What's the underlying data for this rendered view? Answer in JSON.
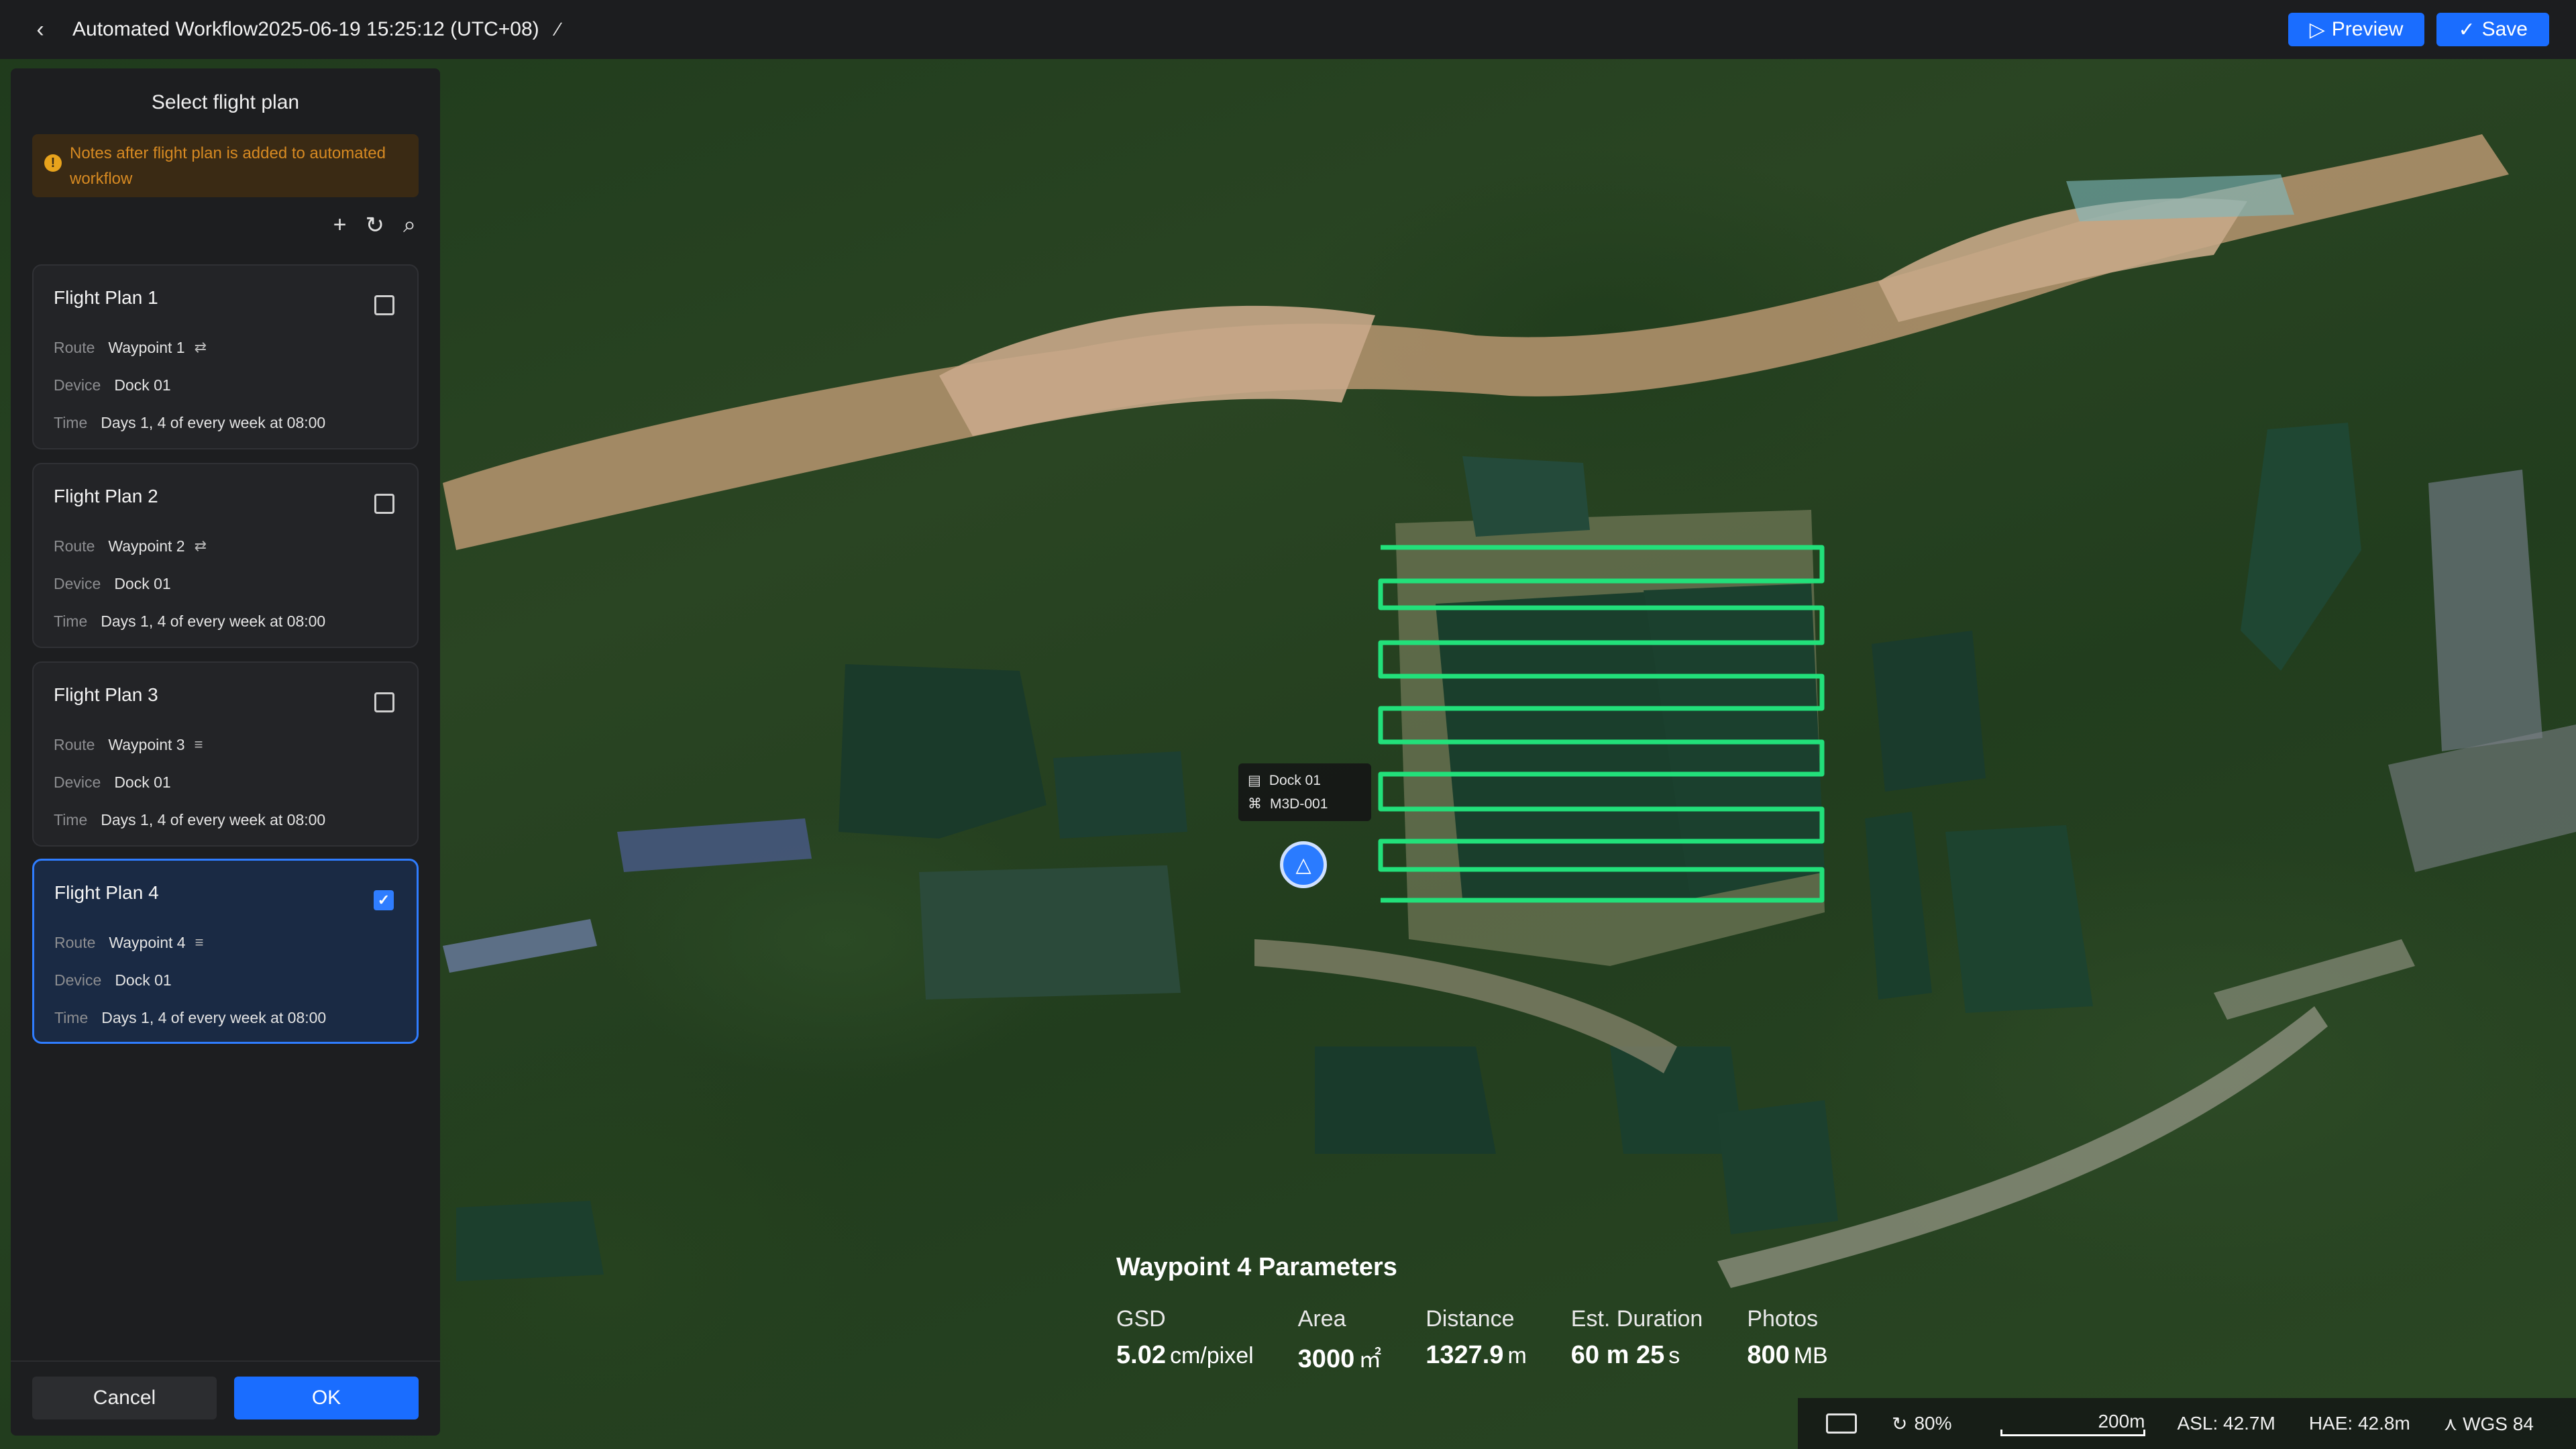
{
  "header": {
    "back_icon": "chevron-left-icon",
    "title": "Automated Workflow2025-06-19 15:25:12 (UTC+08)",
    "edit_icon": "pencil-icon",
    "preview_label": "Preview",
    "save_label": "Save"
  },
  "panel": {
    "title": "Select flight plan",
    "notice": "Notes after flight plan is added to automated workflow",
    "tools": [
      "plus-icon",
      "refresh-icon",
      "search-icon"
    ],
    "plans": [
      {
        "name": "Flight Plan 1",
        "route_label": "Route",
        "route": "Waypoint 1",
        "device_label": "Device",
        "device": "Dock 01",
        "time_label": "Time",
        "time": "Days 1, 4 of every week at 08:00",
        "checked": false
      },
      {
        "name": "Flight Plan 2",
        "route_label": "Route",
        "route": "Waypoint 2",
        "device_label": "Device",
        "device": "Dock 01",
        "time_label": "Time",
        "time": "Days 1, 4 of every week at 08:00",
        "checked": false
      },
      {
        "name": "Flight Plan 3",
        "route_label": "Route",
        "route": "Waypoint 3",
        "device_label": "Device",
        "device": "Dock 01",
        "time_label": "Time",
        "time": "Days 1, 4 of every week at 08:00",
        "checked": false
      },
      {
        "name": "Flight Plan 4",
        "route_label": "Route",
        "route": "Waypoint 4",
        "device_label": "Device",
        "device": "Dock 01",
        "time_label": "Time",
        "time": "Days 1, 4 of every week at 08:00",
        "checked": true
      }
    ],
    "cancel_label": "Cancel",
    "ok_label": "OK"
  },
  "map": {
    "dock_name": "Dock 01",
    "drone_name": "M3D-001",
    "route_color": "#22e07a"
  },
  "parameters": {
    "title": "Waypoint 4 Parameters",
    "items": [
      {
        "label": "GSD",
        "value": "5.02",
        "unit": "cm/pixel"
      },
      {
        "label": "Area",
        "value": "3000",
        "unit": "㎡"
      },
      {
        "label": "Distance",
        "value": "1327.9",
        "unit": "m"
      },
      {
        "label": "Est. Duration",
        "value": "60 m 25",
        "unit": "s"
      },
      {
        "label": "Photos",
        "value": "800",
        "unit": "MB"
      }
    ]
  },
  "status": {
    "zoom": "80%",
    "scale": "200m",
    "asl": "ASL: 42.7M",
    "hae": "HAE:  42.8m",
    "crs": "WGS 84"
  },
  "colors": {
    "accent": "#1a6dff",
    "warning": "#d78a22",
    "selected_border": "#2f7dff"
  }
}
